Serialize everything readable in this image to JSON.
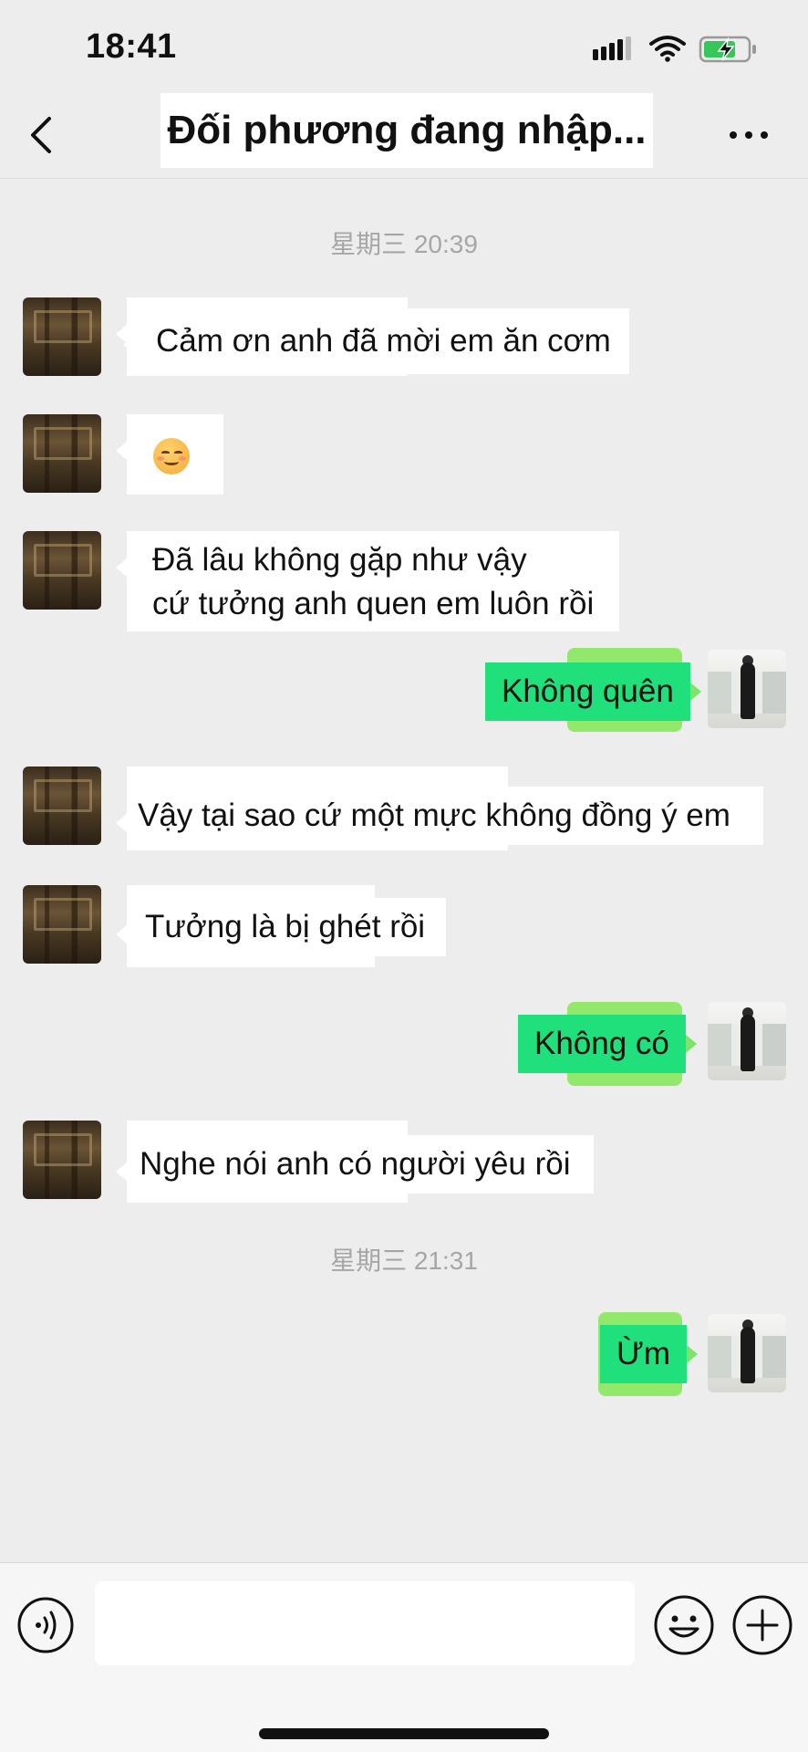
{
  "status_bar": {
    "time": "18:41",
    "icons": [
      "signal-icon",
      "wifi-icon",
      "battery-charging-icon"
    ]
  },
  "navbar": {
    "back_icon": "chevron-left-icon",
    "title": "Đối phương đang nhập...",
    "more_icon": "more-dots-icon"
  },
  "chat": {
    "timestamps": [
      "星期三 20:39",
      "星期三 21:31"
    ],
    "messages": [
      {
        "side": "left",
        "text": "Cảm ơn anh đã mời em ăn cơm"
      },
      {
        "side": "left",
        "emoji": "smiling-face-icon"
      },
      {
        "side": "left",
        "lines": [
          "Đã lâu không gặp như vậy",
          "cứ tưởng anh quen em luôn rồi"
        ]
      },
      {
        "side": "right",
        "text": "Không quên"
      },
      {
        "side": "left",
        "text": "Vậy tại sao cứ một mực không đồng ý em"
      },
      {
        "side": "left",
        "text": "Tưởng là bị ghét rồi"
      },
      {
        "side": "right",
        "text": "Không có"
      },
      {
        "side": "left",
        "text": "Nghe nói anh có người yêu rồi"
      },
      {
        "side": "right",
        "text": "Ừm"
      }
    ]
  },
  "input_bar": {
    "voice_icon": "voice-icon",
    "input_value": "",
    "emoji_icon": "emoji-icon",
    "plus_icon": "plus-icon"
  },
  "colors": {
    "background": "#ededed",
    "bubble_left": "#ffffff",
    "bubble_right": "#1fe07a",
    "bubble_right_halo": "#92e86a",
    "timestamp": "#a6a6a6"
  }
}
